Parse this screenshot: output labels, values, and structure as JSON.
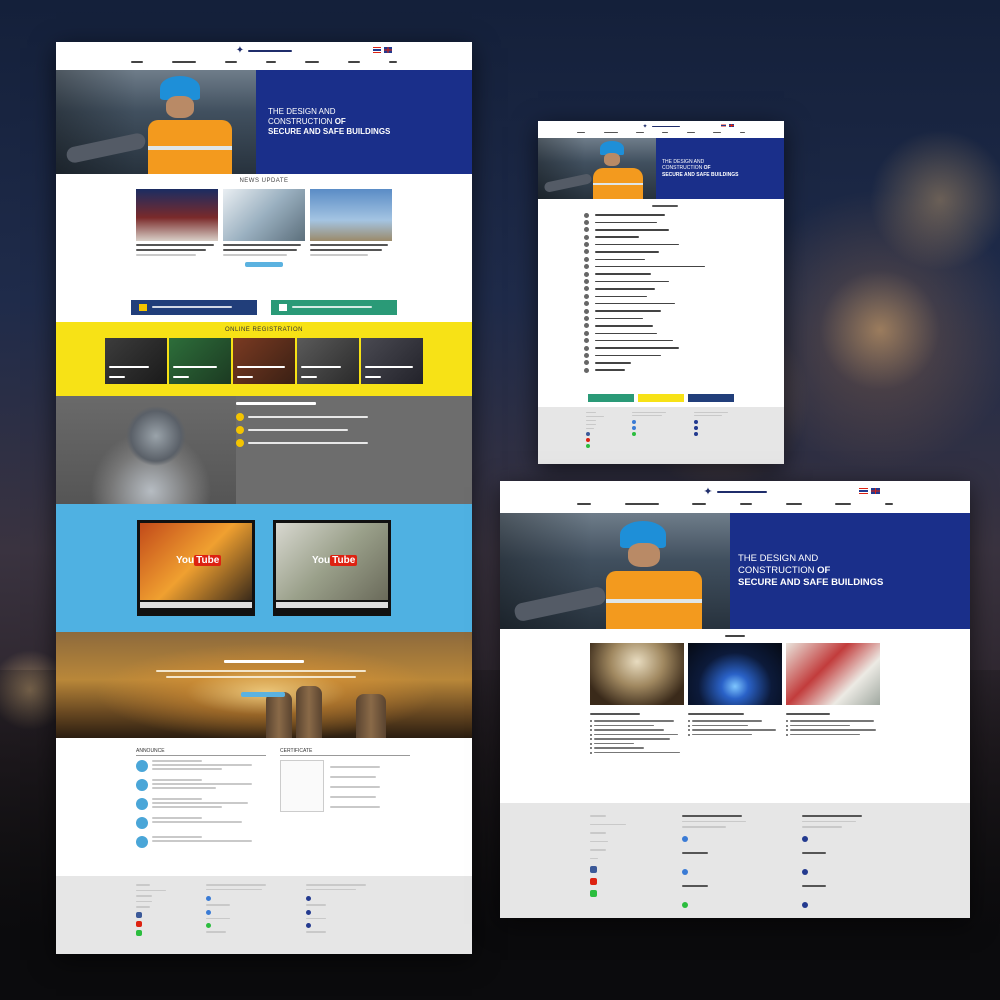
{
  "colors": {
    "brand_blue": "#1a2f8a",
    "yellow": "#f7e216",
    "sky": "#4fb1e2",
    "gray": "#6d6d6d",
    "footer": "#e6e6e6"
  },
  "hero": {
    "line1": "THE DESIGN AND",
    "line2": "CONSTRUCTION",
    "line2_suffix": "OF",
    "line3": "SECURE AND SAFE BUILDINGS"
  },
  "sections": {
    "news": "NEWS UPDATE",
    "online_registration": "ONLINE REGISTRATION",
    "announce": "ANNOUNCE",
    "certificate": "CERTIFICATE",
    "youtube": "YouTube"
  },
  "icons": {
    "logo": "star-logo-icon",
    "flag_th": "thai-flag-icon",
    "flag_en": "uk-flag-icon",
    "social": [
      "facebook-icon",
      "youtube-icon",
      "line-icon"
    ]
  }
}
